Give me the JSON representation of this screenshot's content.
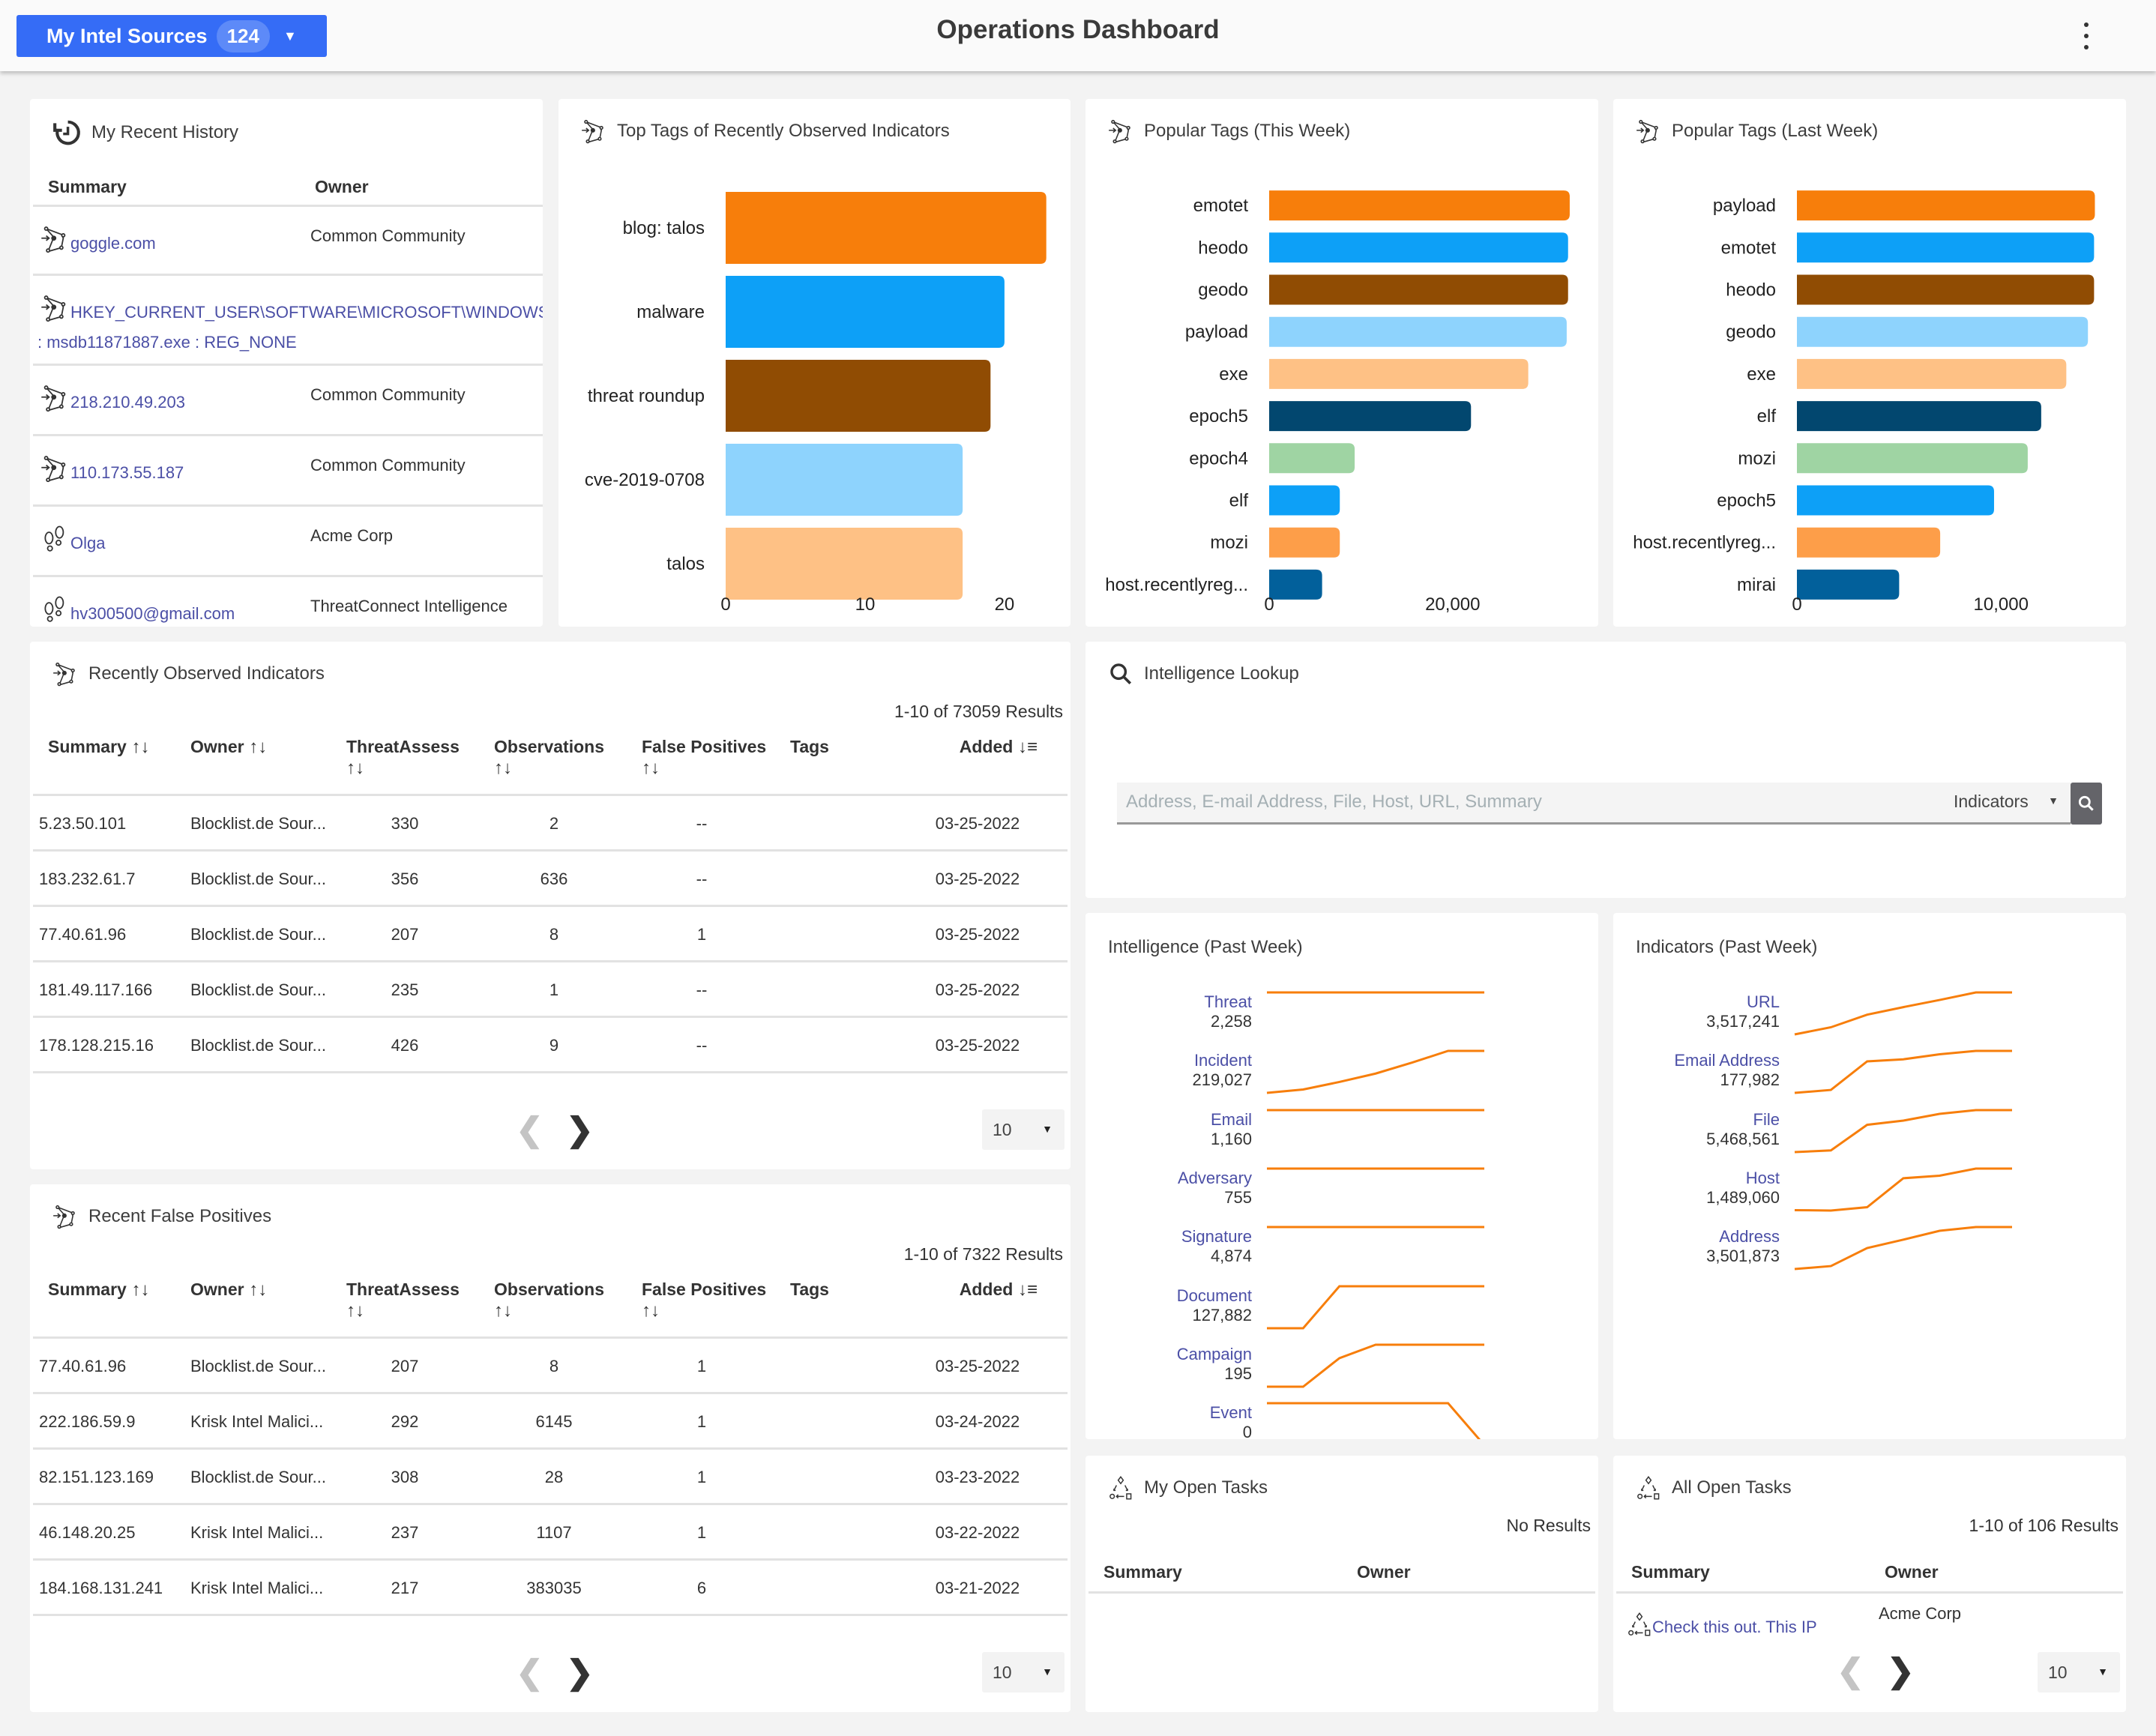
{
  "header": {
    "sources_label": "My Intel Sources",
    "sources_count": "124",
    "title": "Operations Dashboard"
  },
  "recent_history": {
    "title": "My Recent History",
    "columns": [
      "Summary",
      "Owner"
    ],
    "rows": [
      {
        "icon": "indicator-icon",
        "summary": "goggle.com",
        "owner": "Common Community"
      },
      {
        "icon": "indicator-icon",
        "summary": "HKEY_CURRENT_USER\\SOFTWARE\\MICROSOFT\\WINDOWS\\CURR",
        "summary_line2": ": msdb11871887.exe : REG_NONE",
        "owner": ""
      },
      {
        "icon": "indicator-icon",
        "summary": "218.210.49.203",
        "owner": "Common Community"
      },
      {
        "icon": "indicator-icon",
        "summary": "110.173.55.187",
        "owner": "Common Community"
      },
      {
        "icon": "footprints-icon",
        "summary": "Olga",
        "owner": "Acme Corp"
      },
      {
        "icon": "footprints-icon",
        "summary": "hv300500@gmail.com",
        "owner": "ThreatConnect Intelligence"
      }
    ]
  },
  "chart_data": [
    {
      "type": "bar",
      "orientation": "horizontal",
      "title": "Top Tags of Recently Observed Indicators",
      "categories": [
        "blog: talos",
        "malware",
        "threat roundup",
        "cve-2019-0708",
        "talos"
      ],
      "values": [
        23,
        20,
        19,
        17,
        17
      ],
      "colors": [
        "#f77e0b",
        "#0da0f7",
        "#904c03",
        "#8ed3fd",
        "#fec185"
      ],
      "xticks": [
        0,
        10,
        20
      ],
      "xtick_labels": [
        "0",
        "10",
        "20"
      ],
      "xlim": [
        0,
        23.5
      ],
      "grid": false
    },
    {
      "type": "bar",
      "orientation": "horizontal",
      "title": "Popular Tags (This Week)",
      "categories": [
        "emotet",
        "heodo",
        "geodo",
        "payload",
        "exe",
        "epoch5",
        "epoch4",
        "elf",
        "mozi",
        "host.recentlyreg..."
      ],
      "values": [
        32760,
        32580,
        32580,
        32430,
        28240,
        22000,
        9320,
        7700,
        7700,
        5770
      ],
      "colors": [
        "#f77e0b",
        "#0da0f7",
        "#904c03",
        "#8ed3fd",
        "#fec185",
        "#02476f",
        "#9fd4a3",
        "#0da0f7",
        "#fd9e49",
        "#02609b"
      ],
      "xticks": [
        0,
        20000
      ],
      "xtick_labels": [
        "0",
        "20,000"
      ],
      "xlim": [
        0,
        33500
      ],
      "grid": false
    },
    {
      "type": "bar",
      "orientation": "horizontal",
      "title": "Popular Tags (Last Week)",
      "categories": [
        "payload",
        "emotet",
        "heodo",
        "geodo",
        "exe",
        "elf",
        "mozi",
        "epoch5",
        "host.recentlyreg...",
        "mirai"
      ],
      "values": [
        14600,
        14560,
        14560,
        14260,
        13200,
        11970,
        11310,
        9660,
        7020,
        5010
      ],
      "colors": [
        "#f77e0b",
        "#0da0f7",
        "#904c03",
        "#8ed3fd",
        "#fec185",
        "#02476f",
        "#9fd4a3",
        "#0da0f7",
        "#fd9e49",
        "#02609b"
      ],
      "xticks": [
        0,
        10000
      ],
      "xtick_labels": [
        "0",
        "10,000"
      ],
      "xlim": [
        0,
        14950
      ],
      "grid": false
    },
    {
      "type": "line",
      "title": "Intelligence (Past Week)",
      "note": "sparklines; trend values normalized 0-1 per series",
      "series": [
        {
          "name": "Threat",
          "total": "2,258",
          "trend": [
            1,
            1,
            1,
            1,
            1,
            1,
            1
          ]
        },
        {
          "name": "Incident",
          "total": "219,027",
          "trend": [
            0,
            0.08,
            0.26,
            0.46,
            0.72,
            1,
            1
          ]
        },
        {
          "name": "Email",
          "total": "1,160",
          "trend": [
            1,
            1,
            1,
            1,
            1,
            1,
            1
          ]
        },
        {
          "name": "Adversary",
          "total": "755",
          "trend": [
            1,
            1,
            1,
            1,
            1,
            1,
            1
          ]
        },
        {
          "name": "Signature",
          "total": "4,874",
          "trend": [
            1,
            1,
            1,
            1,
            1,
            1,
            1
          ]
        },
        {
          "name": "Document",
          "total": "127,882",
          "trend": [
            0,
            0,
            1,
            1,
            1,
            1,
            1
          ]
        },
        {
          "name": "Campaign",
          "total": "195",
          "trend": [
            0,
            0,
            0.68,
            1,
            1,
            1,
            1
          ]
        },
        {
          "name": "Event",
          "total": "0",
          "trend": [
            1,
            1,
            1,
            1,
            1,
            1,
            0
          ]
        }
      ],
      "line_color": "#f77e0b"
    },
    {
      "type": "line",
      "title": "Indicators (Past Week)",
      "note": "sparklines; trend values normalized 0-1 per series",
      "series": [
        {
          "name": "URL",
          "total": "3,517,241",
          "trend": [
            0,
            0.17,
            0.47,
            0.65,
            0.82,
            1,
            1
          ]
        },
        {
          "name": "Email Address",
          "total": "177,982",
          "trend": [
            0,
            0.07,
            0.75,
            0.8,
            0.92,
            1,
            1
          ]
        },
        {
          "name": "File",
          "total": "5,468,561",
          "trend": [
            0,
            0.04,
            0.65,
            0.75,
            0.91,
            1,
            1
          ]
        },
        {
          "name": "Host",
          "total": "1,489,060",
          "trend": [
            0.01,
            0,
            0.08,
            0.77,
            0.83,
            1,
            1
          ]
        },
        {
          "name": "Address",
          "total": "3,501,873",
          "trend": [
            0,
            0.07,
            0.5,
            0.7,
            0.91,
            1,
            1
          ]
        }
      ],
      "line_color": "#f77e0b"
    }
  ],
  "observed": {
    "title": "Recently Observed Indicators",
    "results": "1-10 of 73059 Results",
    "columns": [
      "Summary",
      "Owner",
      "ThreatAssess",
      "Observations",
      "False Positives",
      "Tags",
      "Added"
    ],
    "rows": [
      {
        "summary": "5.23.50.101",
        "owner": "Blocklist.de Sour...",
        "threat": "330",
        "obs": "2",
        "fp": "--",
        "tags": "",
        "added": "03-25-2022"
      },
      {
        "summary": "183.232.61.7",
        "owner": "Blocklist.de Sour...",
        "threat": "356",
        "obs": "636",
        "fp": "--",
        "tags": "",
        "added": "03-25-2022"
      },
      {
        "summary": "77.40.61.96",
        "owner": "Blocklist.de Sour...",
        "threat": "207",
        "obs": "8",
        "fp": "1",
        "tags": "",
        "added": "03-25-2022"
      },
      {
        "summary": "181.49.117.166",
        "owner": "Blocklist.de Sour...",
        "threat": "235",
        "obs": "1",
        "fp": "--",
        "tags": "",
        "added": "03-25-2022"
      },
      {
        "summary": "178.128.215.16",
        "owner": "Blocklist.de Sour...",
        "threat": "426",
        "obs": "9",
        "fp": "--",
        "tags": "",
        "added": "03-25-2022"
      }
    ],
    "page_size": "10"
  },
  "false_positives": {
    "title": "Recent False Positives",
    "results": "1-10 of 7322 Results",
    "columns": [
      "Summary",
      "Owner",
      "ThreatAssess",
      "Observations",
      "False Positives",
      "Tags",
      "Added"
    ],
    "rows": [
      {
        "summary": "77.40.61.96",
        "owner": "Blocklist.de Sour...",
        "threat": "207",
        "obs": "8",
        "fp": "1",
        "tags": "",
        "added": "03-25-2022"
      },
      {
        "summary": "222.186.59.9",
        "owner": "Krisk Intel Malici...",
        "threat": "292",
        "obs": "6145",
        "fp": "1",
        "tags": "",
        "added": "03-24-2022"
      },
      {
        "summary": "82.151.123.169",
        "owner": "Blocklist.de Sour...",
        "threat": "308",
        "obs": "28",
        "fp": "1",
        "tags": "",
        "added": "03-23-2022"
      },
      {
        "summary": "46.148.20.25",
        "owner": "Krisk Intel Malici...",
        "threat": "237",
        "obs": "1107",
        "fp": "1",
        "tags": "",
        "added": "03-22-2022"
      },
      {
        "summary": "184.168.131.241",
        "owner": "Krisk Intel Malici...",
        "threat": "217",
        "obs": "383035",
        "fp": "6",
        "tags": "",
        "added": "03-21-2022"
      }
    ],
    "page_size": "10"
  },
  "lookup": {
    "title": "Intelligence Lookup",
    "placeholder": "Address, E-mail Address, File, Host, URL, Summary",
    "value": "",
    "type": "Indicators"
  },
  "my_tasks": {
    "title": "My Open Tasks",
    "results": "No Results",
    "columns": [
      "Summary",
      "Owner"
    ],
    "rows": []
  },
  "all_tasks": {
    "title": "All Open Tasks",
    "results": "1-10 of 106 Results",
    "columns": [
      "Summary",
      "Owner"
    ],
    "rows": [
      {
        "summary": "Check this out. This IP",
        "owner": "Acme Corp"
      }
    ],
    "page_size": "10"
  },
  "colors": {
    "accent": "#356cf6",
    "link": "#4b4fa6",
    "sparkline": "#f77e0b"
  }
}
